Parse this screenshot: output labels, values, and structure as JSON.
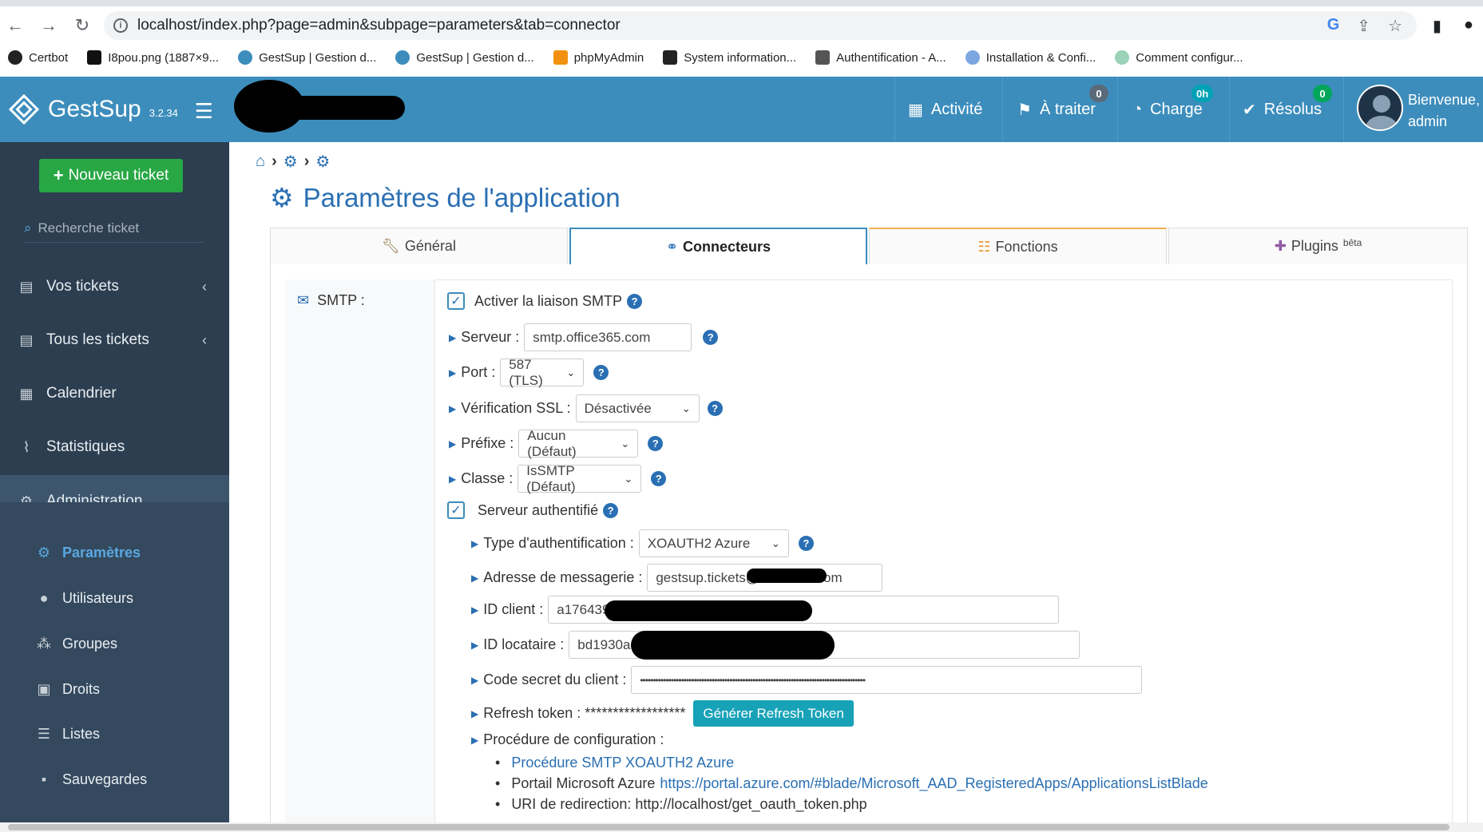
{
  "browser": {
    "url": "localhost/index.php?page=admin&subpage=parameters&tab=connector",
    "bookmarks": [
      {
        "label": "Certbot"
      },
      {
        "label": "I8pou.png (1887×9..."
      },
      {
        "label": "GestSup | Gestion d..."
      },
      {
        "label": "GestSup | Gestion d..."
      },
      {
        "label": "phpMyAdmin"
      },
      {
        "label": "System information..."
      },
      {
        "label": "Authentification - A..."
      },
      {
        "label": "Installation & Confi..."
      },
      {
        "label": "Comment configur..."
      }
    ]
  },
  "brand": {
    "name": "GestSup",
    "version": "3.2.34"
  },
  "topnav": {
    "activite": "Activité",
    "a_traiter": "À traiter",
    "a_traiter_badge": "0",
    "charge": "Charge",
    "charge_badge": "0h",
    "resolus": "Résolus",
    "resolus_badge": "0",
    "welcome_line1": "Bienvenue,",
    "welcome_line2": "admin"
  },
  "sidebar": {
    "new_ticket": "Nouveau ticket",
    "search_placeholder": "Recherche ticket",
    "items": [
      {
        "label": "Vos tickets"
      },
      {
        "label": "Tous les tickets"
      },
      {
        "label": "Calendrier"
      },
      {
        "label": "Statistiques"
      },
      {
        "label": "Administration"
      }
    ],
    "subitems": [
      {
        "label": "Paramètres"
      },
      {
        "label": "Utilisateurs"
      },
      {
        "label": "Groupes"
      },
      {
        "label": "Droits"
      },
      {
        "label": "Listes"
      },
      {
        "label": "Sauvegardes"
      }
    ]
  },
  "page": {
    "title": "Paramètres de l'application",
    "tabs": [
      {
        "label": "Général"
      },
      {
        "label": "Connecteurs"
      },
      {
        "label": "Fonctions"
      },
      {
        "label": "Plugins",
        "sup": "bêta"
      }
    ]
  },
  "smtp": {
    "section_label": "SMTP :",
    "enable_label": "Activer la liaison SMTP",
    "server_label": "Serveur :",
    "server_value": "smtp.office365.com",
    "port_label": "Port :",
    "port_value": "587 (TLS)",
    "ssl_label": "Vérification SSL :",
    "ssl_value": "Désactivée",
    "prefix_label": "Préfixe :",
    "prefix_value": "Aucun (Défaut)",
    "class_label": "Classe :",
    "class_value": "IsSMTP (Défaut)",
    "auth_label": "Serveur authentifié",
    "auth_type_label": "Type d'authentification :",
    "auth_type_value": "XOAUTH2 Azure",
    "email_label": "Adresse de messagerie :",
    "email_value": "gestsup.tickets@",
    "email_value_end": "om",
    "client_id_label": "ID client :",
    "client_id_value": "a176439",
    "tenant_label": "ID locataire :",
    "tenant_value": "bd1930ae",
    "secret_label": "Code secret du client :",
    "secret_value": "••••••••••••••••••••••••••••••••••••••••••••••••••••••••••••••••••••••••••••••••••••••••",
    "refresh_label": "Refresh token : ******************",
    "refresh_button": "Générer Refresh Token",
    "procedure_label": "Procédure de configuration :",
    "proc_item1": "Procédure SMTP XOAUTH2 Azure",
    "proc_item2_prefix": "Portail Microsoft Azure",
    "proc_item2_link": "https://portal.azure.com/#blade/Microsoft_AAD_RegisteredApps/ApplicationsListBlade",
    "proc_item3": "URI de redirection: http://localhost/get_oauth_token.php"
  },
  "colors": {
    "header_blue": "#3c8dbc",
    "sidebar_dark": "#2c3e50",
    "new_ticket_green": "#28a745",
    "link_blue": "#2a6fb3",
    "button_teal": "#17a2b8"
  }
}
